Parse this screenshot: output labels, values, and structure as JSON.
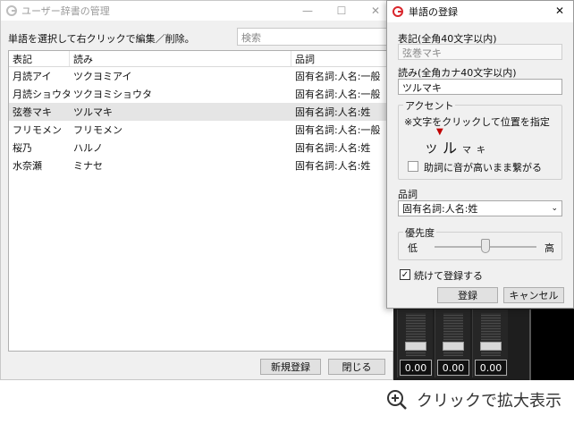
{
  "dict_window": {
    "title": "ユーザー辞書の管理",
    "controls": {
      "minimize": "—",
      "maximize": "☐",
      "close": "✕"
    },
    "hint": "単語を選択して右クリックで編集／削除。",
    "search_placeholder": "検索",
    "columns": [
      "表記",
      "読み",
      "品詞"
    ],
    "rows": [
      {
        "surface": "月読アイ",
        "reading": "ツクヨミアイ",
        "pos": "固有名詞:人名:一般"
      },
      {
        "surface": "月読ショウタ",
        "reading": "ツクヨミショウタ",
        "pos": "固有名詞:人名:一般"
      },
      {
        "surface": "弦巻マキ",
        "reading": "ツルマキ",
        "pos": "固有名詞:人名:姓"
      },
      {
        "surface": "フリモメン",
        "reading": "フリモメン",
        "pos": "固有名詞:人名:一般"
      },
      {
        "surface": "桜乃",
        "reading": "ハルノ",
        "pos": "固有名詞:人名:姓"
      },
      {
        "surface": "水奈瀬",
        "reading": "ミナセ",
        "pos": "固有名詞:人名:姓"
      }
    ],
    "new_button": "新規登録",
    "close_button": "閉じる"
  },
  "register_dialog": {
    "title": "単語の登録",
    "surface_label": "表記(全角40文字以内)",
    "surface_value": "弦巻マキ",
    "reading_label": "読み(全角カナ40文字以内)",
    "reading_value": "ツルマキ",
    "accent_group": "アクセント",
    "accent_hint": "※文字をクリックして位置を指定",
    "accent_marker": "▼",
    "accent_chars": [
      "ツ",
      "ル",
      "マ",
      "キ"
    ],
    "particle_checkbox": "助詞に音が高いまま繋がる",
    "pos_label": "品詞",
    "pos_value": "固有名詞:人名:姓",
    "priority_group": "優先度",
    "priority_low": "低",
    "priority_high": "高",
    "priority_level": 0.5,
    "continue_checkbox": "続けて登録する",
    "continue_checked": true,
    "register_button": "登録",
    "cancel_button": "キャンセル"
  },
  "mixer": {
    "values": [
      "0.00",
      "0.00",
      "0.00"
    ]
  },
  "zoom_caption": "クリックで拡大表示",
  "colors": {
    "accent_marker": "#c00000",
    "app_icon": "#d9262c"
  }
}
